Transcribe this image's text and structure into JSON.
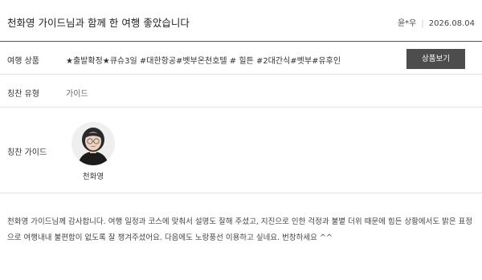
{
  "header": {
    "title": "천화영 가이드님과 함께 한 여행 좋았습니다",
    "author": "윤*우",
    "date": "2026.08.04"
  },
  "product": {
    "label": "여행 상품",
    "value": "★출발확정★큐슈3일 #대한항공#벳부온천호텔 # 힐튼 #2대간식#벳부#유후인",
    "button_label": "상품보기"
  },
  "praise_type": {
    "label": "칭찬 유형",
    "value": "가이드"
  },
  "praise_guide": {
    "label": "칭찬 가이드",
    "name": "천화영"
  },
  "review": {
    "text": "천화영 가이드님께 감사합니다. 여행 일정과 코스에 맞춰서 설명도 잘해 주셨고, 지진으로 인한 걱정과 불볕 더위 때문에 힘든 상황에서도 밝은 표정으로 여행내내 불편함이 없도록 잘 챙겨주셨어요. 다음에도 노랑풍선 이용하고 싶네요. 번창하세요 ^^"
  }
}
